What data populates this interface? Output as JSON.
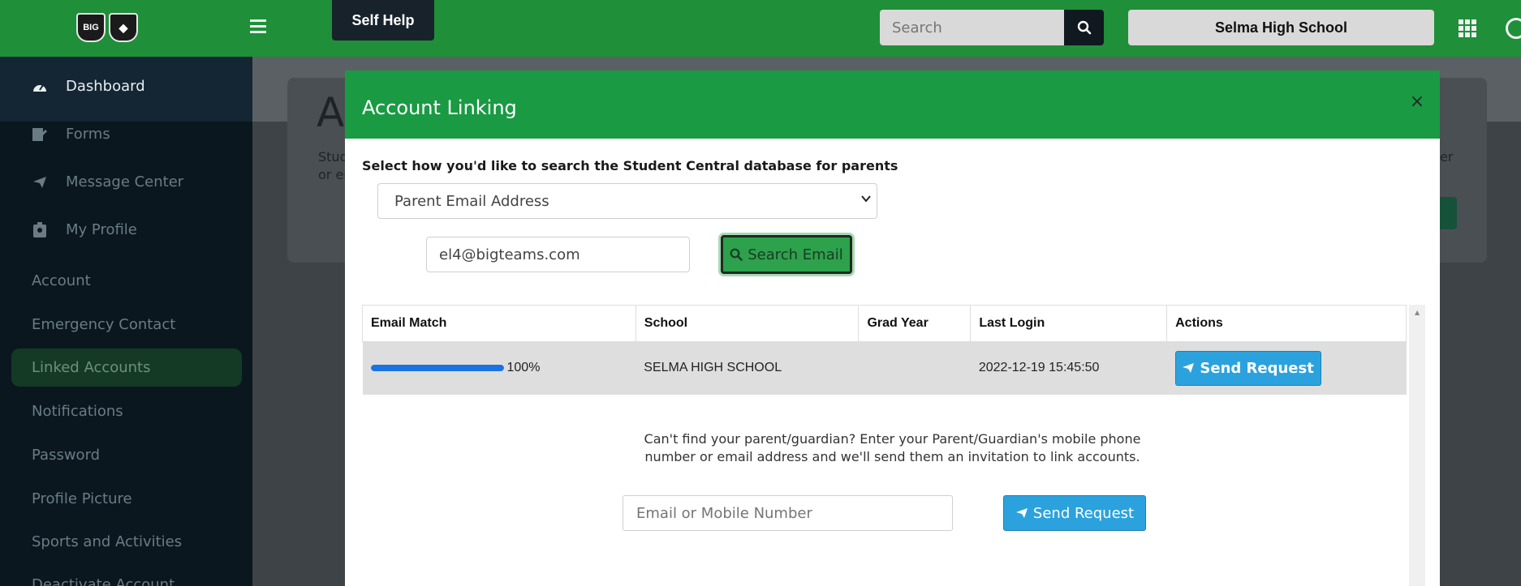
{
  "header": {
    "logo_text_1": "BIG TEAMS",
    "self_help_label": "Self Help",
    "search_placeholder": "Search",
    "school_name": "Selma High School"
  },
  "sidebar": {
    "primary": [
      {
        "label": "Dashboard",
        "icon": "dashboard-icon",
        "active": true
      },
      {
        "label": "Forms",
        "icon": "forms-icon"
      },
      {
        "label": "Message Center",
        "icon": "paper-plane-icon"
      },
      {
        "label": "My Profile",
        "icon": "id-badge-icon"
      }
    ],
    "sub": [
      {
        "label": "Account"
      },
      {
        "label": "Emergency Contact"
      },
      {
        "label": "Linked Accounts",
        "active": true
      },
      {
        "label": "Notifications"
      },
      {
        "label": "Password"
      },
      {
        "label": "Profile Picture"
      },
      {
        "label": "Sports and Activities"
      },
      {
        "label": "Deactivate Account"
      }
    ]
  },
  "background_page": {
    "heading_fragment": "A",
    "text_left_1": "Stud",
    "text_left_2": "or er",
    "text_right": "er"
  },
  "modal": {
    "title": "Account Linking",
    "instruction": "Select how you'd like to search the Student Central database for parents",
    "search_type_selected": "Parent Email Address",
    "email_value": "el4@bigteams.com",
    "search_button_label": "Search Email",
    "table": {
      "columns": [
        "Email Match",
        "School",
        "Grad Year",
        "Last Login",
        "Actions"
      ],
      "rows": [
        {
          "match_percent": 100,
          "match_label": "100%",
          "school": "SELMA HIGH SCHOOL",
          "grad_year": "",
          "last_login": "2022-12-19 15:45:50",
          "action_label": "Send Request"
        }
      ]
    },
    "cant_find_line1": "Can't find your parent/guardian? Enter your Parent/Guardian's mobile phone",
    "cant_find_line2": "number or email address and we'll send them an invitation to link accounts.",
    "invite_placeholder": "Email or Mobile Number",
    "invite_button_label": "Send Request"
  },
  "colors": {
    "header_green": "#1f8f3a",
    "modal_header_green": "#1a9a43",
    "sidebar_dark": "#0b171f",
    "button_blue": "#2ba2dd",
    "progress_blue": "#1a73e0"
  }
}
